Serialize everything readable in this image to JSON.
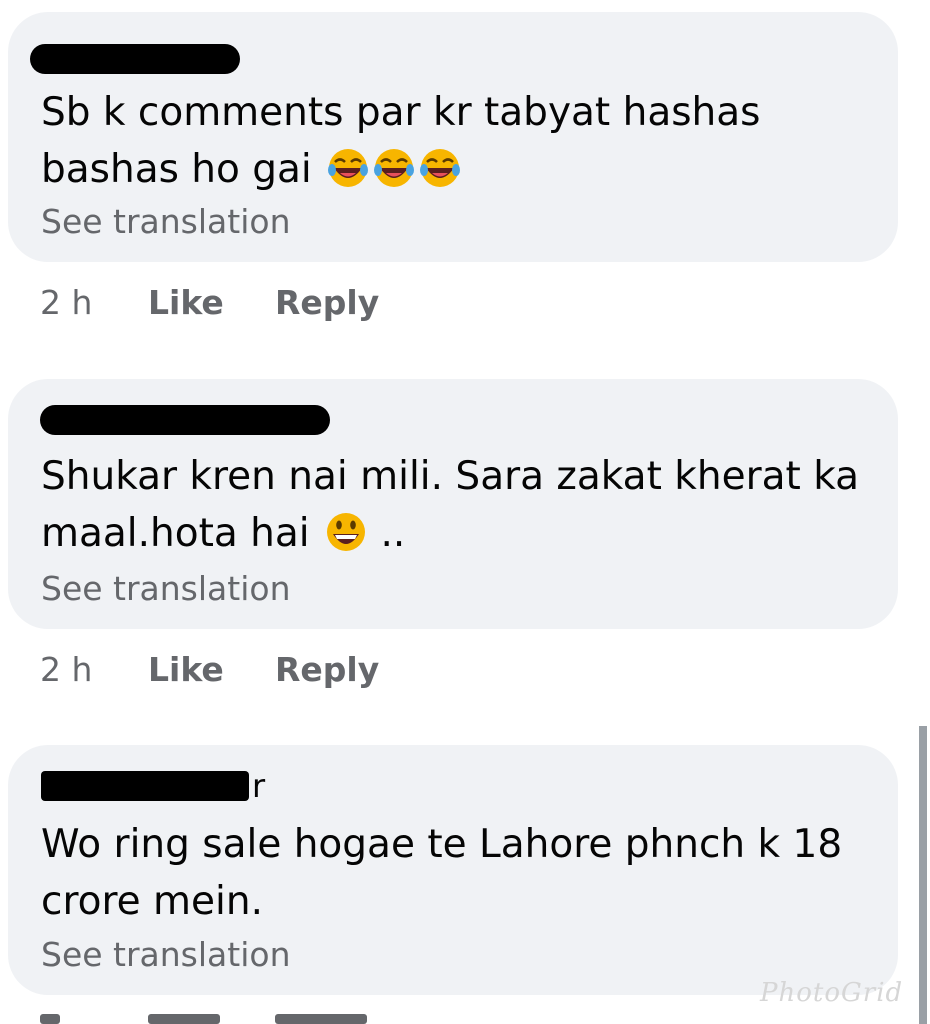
{
  "comments": [
    {
      "author_visible": "",
      "text": "Sb k comments par kr tabyat hashas bashas ho gai",
      "emojis": [
        "face-with-tears-of-joy-icon",
        "face-with-tears-of-joy-icon",
        "face-with-tears-of-joy-icon"
      ],
      "see_translation": "See translation",
      "time": "2 h",
      "like": "Like",
      "reply": "Reply"
    },
    {
      "author_visible": "",
      "text": "Shukar kren nai mili. Sara zakat kherat ka maal.hota hai",
      "text_suffix": " ..",
      "emojis": [
        "grinning-face-icon"
      ],
      "see_translation": "See translation",
      "time": "2 h",
      "like": "Like",
      "reply": "Reply"
    },
    {
      "author_visible": "r",
      "text": "Wo ring sale hogae te Lahore phnch k 18 crore mein.",
      "see_translation": "See translation",
      "time": "",
      "like": "",
      "reply": ""
    }
  ],
  "watermark": "PhotoGrid",
  "colors": {
    "bubble": "#f0f2f5",
    "text": "#050505",
    "secondary": "#65676b"
  }
}
